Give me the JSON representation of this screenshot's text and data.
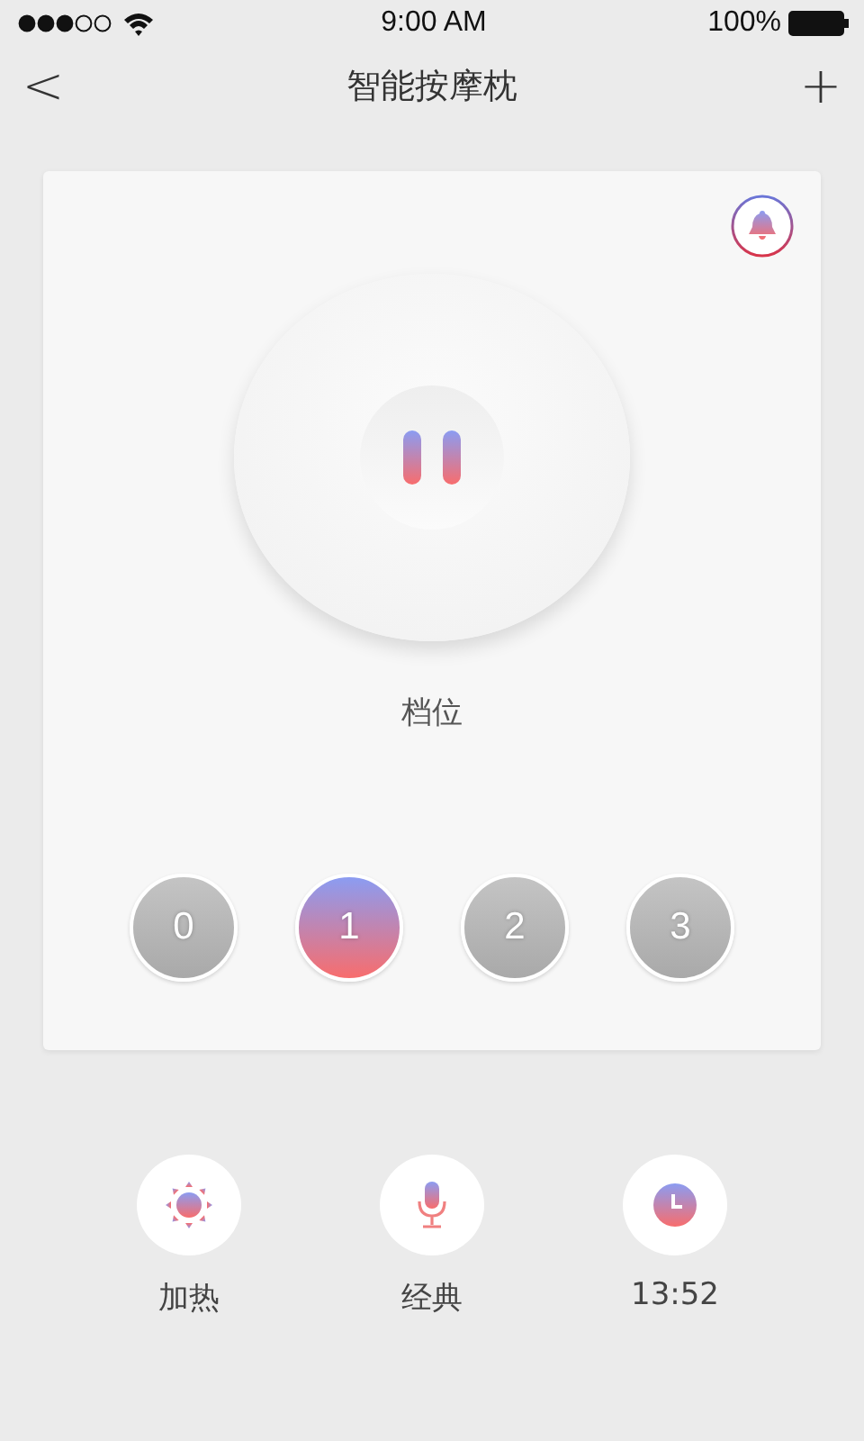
{
  "status_bar": {
    "time": "9:00 AM",
    "battery": "100%"
  },
  "nav": {
    "back": "<",
    "title": "智能按摩枕",
    "add": "+"
  },
  "panel": {
    "playing": true,
    "level_label": "档位",
    "levels": [
      {
        "label": "0",
        "selected": false
      },
      {
        "label": "1",
        "selected": true
      },
      {
        "label": "2",
        "selected": false
      },
      {
        "label": "3",
        "selected": false
      }
    ]
  },
  "actions": [
    {
      "kind": "heat",
      "label": "加热"
    },
    {
      "kind": "mode",
      "label": "经典"
    },
    {
      "kind": "timer",
      "label": "13:52"
    }
  ]
}
